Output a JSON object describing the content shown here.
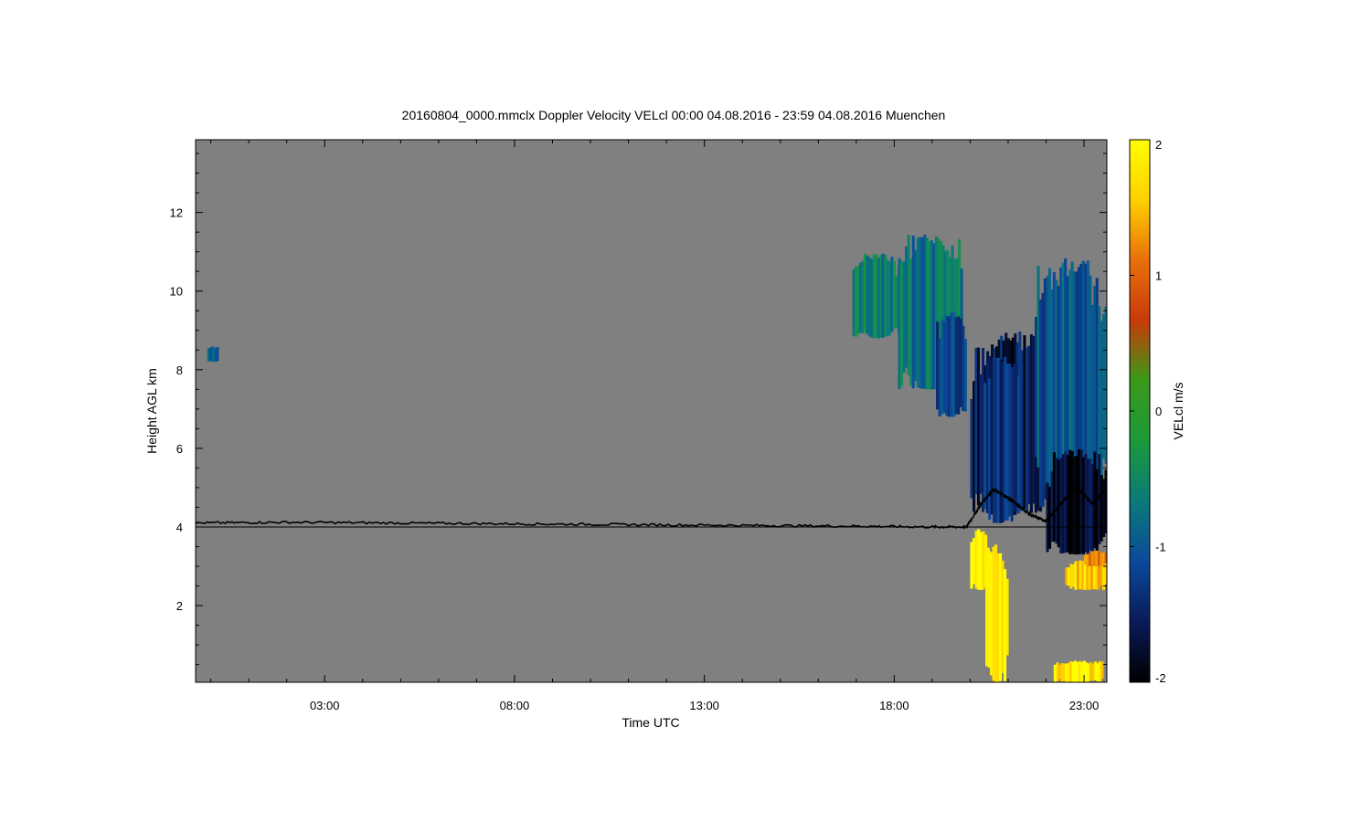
{
  "chart_data": {
    "type": "heatmap",
    "title": "20160804_0000.mmclx Doppler Velocity VELcl   00:00 04.08.2016 - 23:59 04.08.2016 Muenchen",
    "xlabel": "Time UTC",
    "ylabel": "Height AGL km",
    "x_ticks": [
      "03:00",
      "08:00",
      "13:00",
      "18:00",
      "23:00"
    ],
    "x_tick_hours": [
      3,
      8,
      13,
      18,
      23
    ],
    "xlim_hours": [
      -0.4,
      23.6
    ],
    "y_ticks": [
      2,
      4,
      6,
      8,
      10,
      12
    ],
    "ylim": [
      0.05,
      13.85
    ],
    "background_color": "#808080",
    "colorbar": {
      "label": "VELcl m/s",
      "ticks": [
        2,
        1,
        0,
        -1,
        -2
      ],
      "range": [
        -2,
        2
      ],
      "colors": [
        "#000000",
        "#0a1a5a",
        "#0a4a9a",
        "#0a7a7a",
        "#1a9a3a",
        "#3a9a1a",
        "#c83a0a",
        "#e8700a",
        "#ffd000",
        "#ffff00"
      ]
    },
    "melting_layer_km": 4.0,
    "cloud_regions": [
      {
        "t0": 16.9,
        "t1": 18.2,
        "z0": 8.8,
        "z1": 11.0,
        "velocity": -0.6
      },
      {
        "t0": 18.1,
        "t1": 19.8,
        "z0": 7.5,
        "z1": 11.5,
        "velocity": -0.7
      },
      {
        "t0": 19.1,
        "t1": 19.9,
        "z0": 6.8,
        "z1": 9.5,
        "velocity": -1.1
      },
      {
        "t0": 20.0,
        "t1": 22.0,
        "z0": 4.3,
        "z1": 9.0,
        "velocity": -1.6
      },
      {
        "t0": 20.3,
        "t1": 21.3,
        "z0": 4.1,
        "z1": 8.5,
        "velocity": -1.3
      },
      {
        "t0": 21.7,
        "t1": 23.6,
        "z0": 4.5,
        "z1": 10.9,
        "velocity": -1.0
      },
      {
        "t0": 22.0,
        "t1": 23.6,
        "z0": 3.3,
        "z1": 6.0,
        "velocity": -1.8
      },
      {
        "t0": 20.0,
        "t1": 20.5,
        "z0": 2.4,
        "z1": 4.0,
        "velocity": 2.0
      },
      {
        "t0": 20.4,
        "t1": 21.0,
        "z0": 0.05,
        "z1": 3.6,
        "velocity": 1.9
      },
      {
        "t0": 22.2,
        "t1": 23.5,
        "z0": 0.05,
        "z1": 0.6,
        "velocity": 1.8
      },
      {
        "t0": 22.5,
        "t1": 23.6,
        "z0": 2.4,
        "z1": 3.2,
        "velocity": 1.6
      },
      {
        "t0": 23.0,
        "t1": 23.6,
        "z0": 3.0,
        "z1": 3.4,
        "velocity": 1.1
      },
      {
        "t0": -0.1,
        "t1": 0.2,
        "z0": 8.2,
        "z1": 8.6,
        "velocity": -0.8
      }
    ],
    "line_series": {
      "name": "",
      "t": [
        -0.4,
        2,
        5,
        8,
        11,
        14,
        17,
        19,
        19.9,
        20.3,
        20.6,
        20.9,
        21.2,
        21.6,
        22.0,
        22.4,
        22.8,
        23.2,
        23.6
      ],
      "z": [
        4.1,
        4.12,
        4.1,
        4.08,
        4.06,
        4.04,
        4.02,
        4.0,
        4.0,
        4.6,
        4.95,
        4.8,
        4.6,
        4.3,
        4.15,
        4.6,
        5.05,
        4.6,
        4.95
      ]
    }
  }
}
